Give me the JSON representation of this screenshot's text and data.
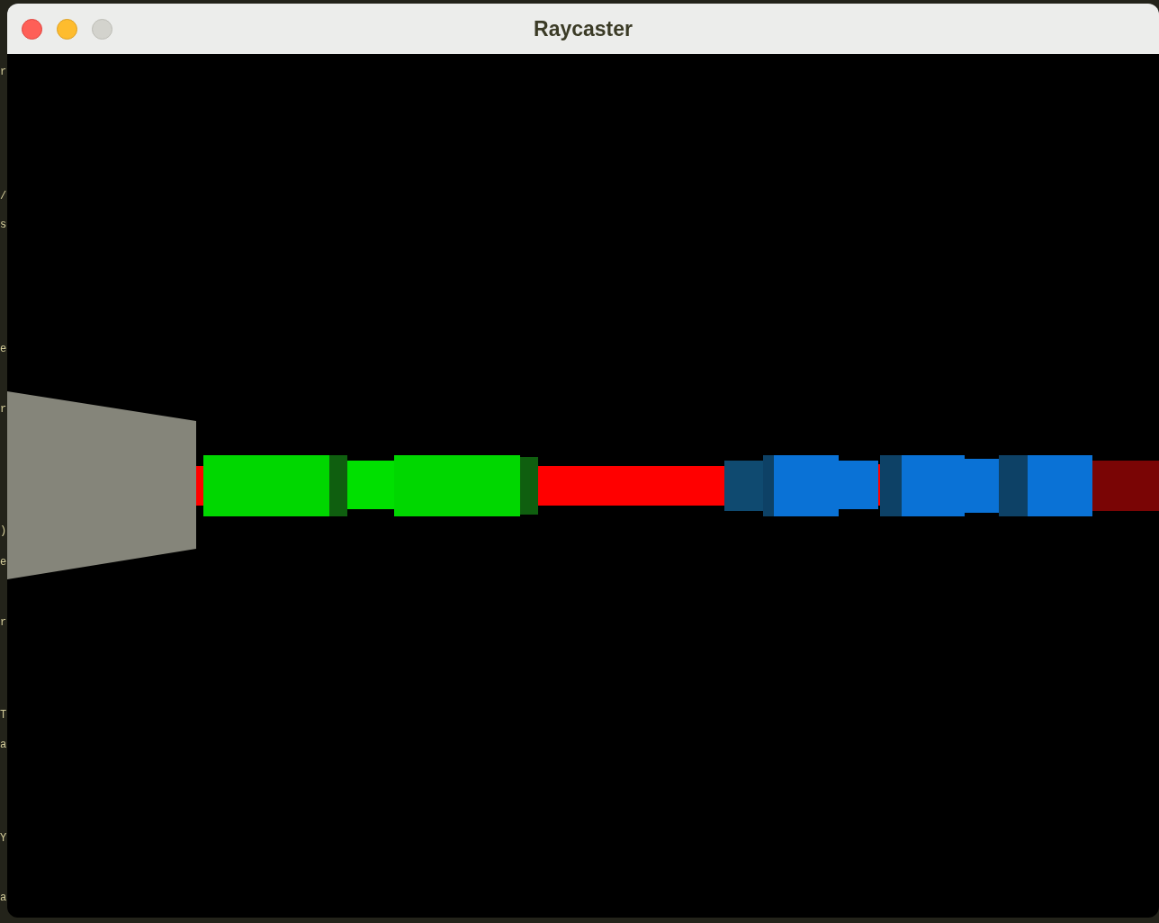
{
  "background_editor": {
    "line_starts": [
      "r",
      "/",
      "s",
      "e",
      "r",
      ")",
      "e",
      "r",
      "T",
      "a",
      "Y",
      "a"
    ]
  },
  "window": {
    "title": "Raycaster",
    "controls": [
      {
        "kind": "close"
      },
      {
        "kind": "minimize"
      },
      {
        "kind": "zoom"
      }
    ]
  }
}
